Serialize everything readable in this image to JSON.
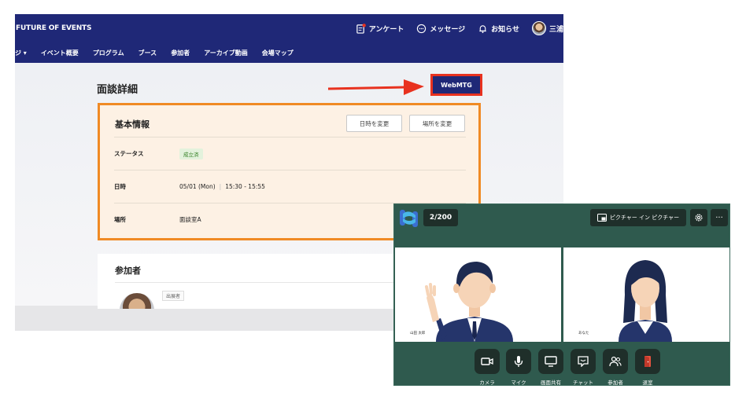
{
  "app": {
    "brand": "FUTURE OF EVENTS",
    "topbar": {
      "survey": "アンケート",
      "messages": "メッセージ",
      "notifications": "お知らせ",
      "user": "三浦"
    },
    "nav": [
      "ジ ▾",
      "イベント概要",
      "プログラム",
      "ブース",
      "参加者",
      "アーカイブ動画",
      "会場マップ"
    ],
    "page_title": "面談詳細",
    "webmtg_label": "WebMTG",
    "accent": "#1f2877",
    "highlight_color": "#e8321f"
  },
  "basic_info": {
    "title": "基本情報",
    "change_datetime": "日時を変更",
    "change_place": "場所を変更",
    "rows": {
      "status_label": "ステータス",
      "status_value": "成立済",
      "datetime_label": "日時",
      "date": "05/01 (Mon)",
      "time": "15:30 - 15:55",
      "place_label": "場所",
      "place_value": "面談室A"
    }
  },
  "participants": {
    "title": "参加者",
    "role": "出展者"
  },
  "video": {
    "count": "2/200",
    "pip_label": "ピクチャー イン ピクチャー",
    "tiles": [
      {
        "name": "山田 太郎"
      },
      {
        "name": "あなた"
      }
    ],
    "controls": [
      "カメラ",
      "マイク",
      "画面共有",
      "チャット",
      "参加者",
      "退室"
    ],
    "bg_color": "#2f5a4e"
  }
}
